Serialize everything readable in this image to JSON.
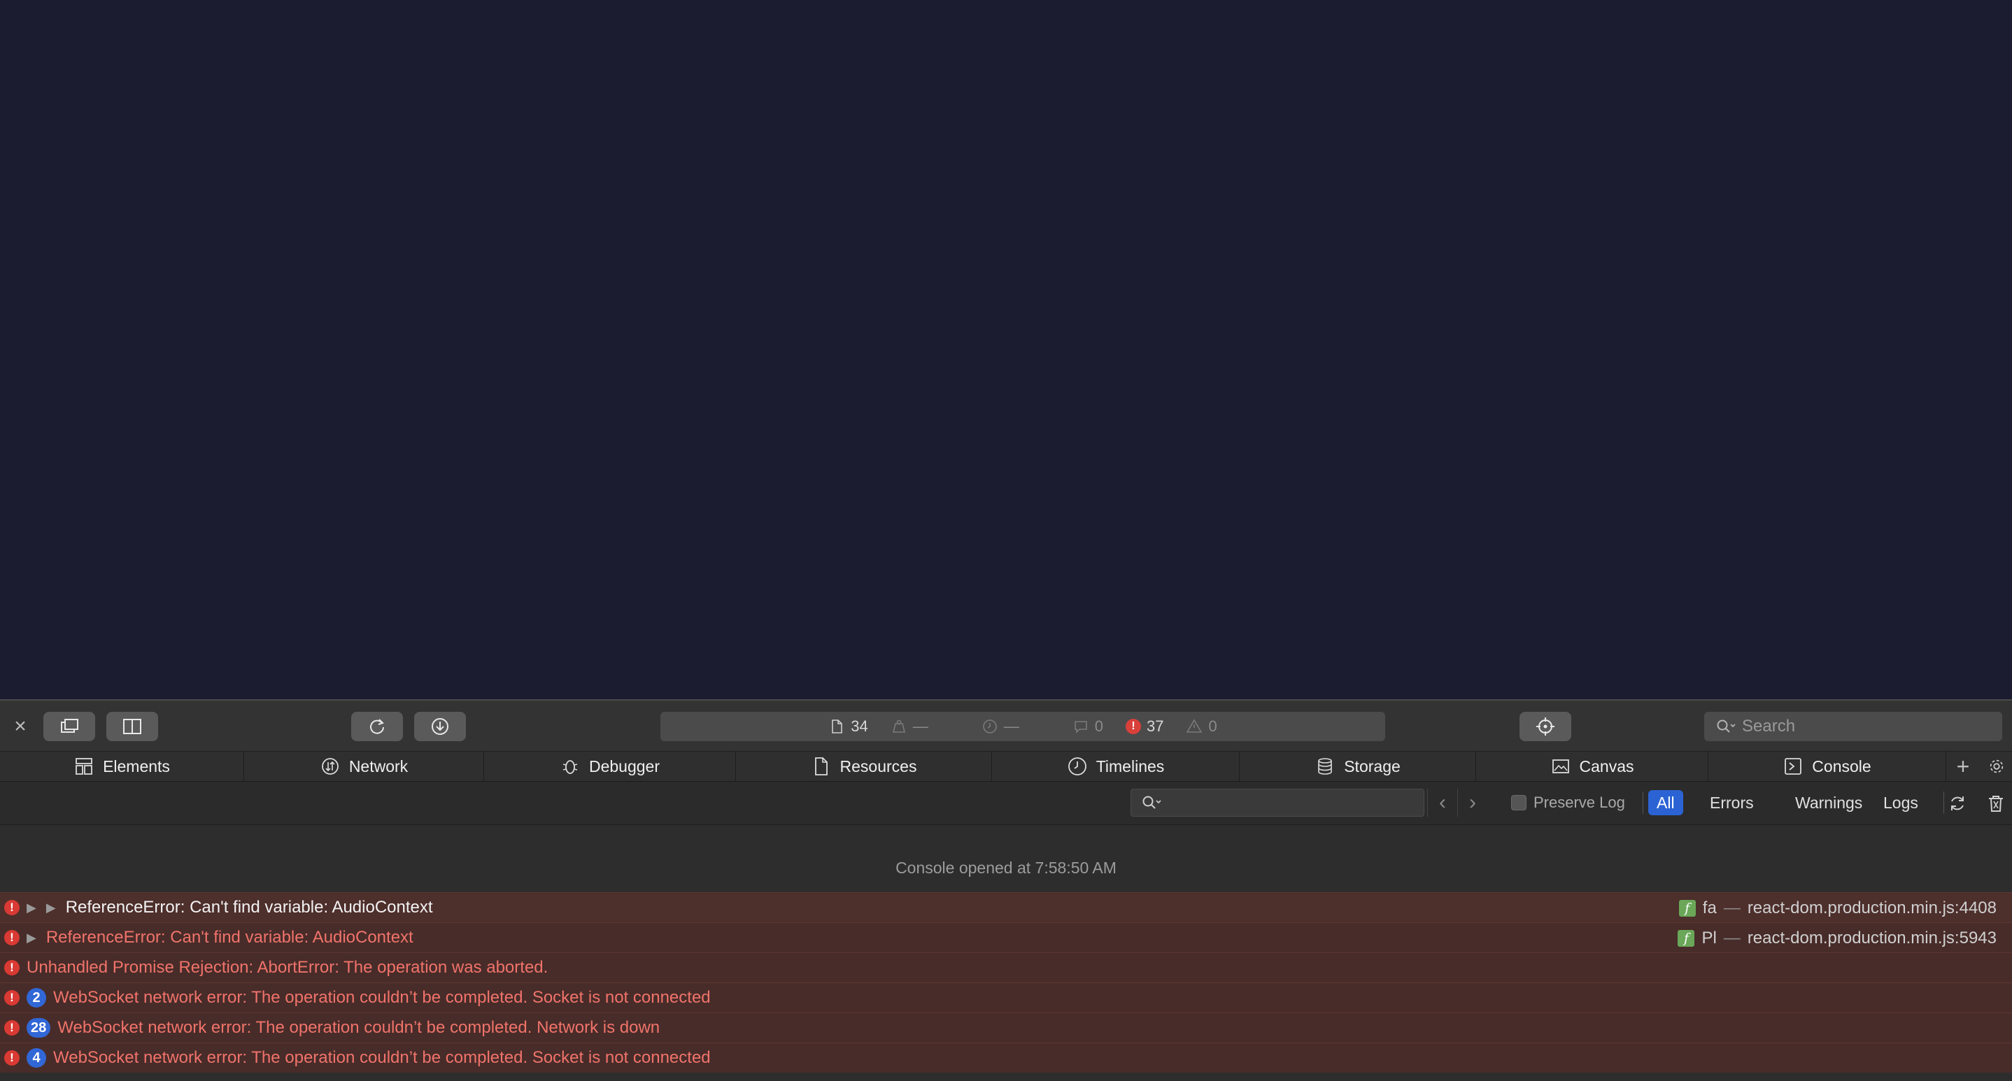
{
  "toolbar": {
    "close_glyph": "×",
    "activity": {
      "resources_count": "34",
      "resources_size": "—",
      "load_time": "—",
      "logs": "0",
      "errors": "37",
      "warnings": "0"
    },
    "search_placeholder": "Search"
  },
  "tabs": [
    {
      "label": "Elements",
      "icon": "elements-icon"
    },
    {
      "label": "Network",
      "icon": "network-icon"
    },
    {
      "label": "Debugger",
      "icon": "debugger-icon"
    },
    {
      "label": "Resources",
      "icon": "resources-icon"
    },
    {
      "label": "Timelines",
      "icon": "timelines-icon"
    },
    {
      "label": "Storage",
      "icon": "storage-icon"
    },
    {
      "label": "Canvas",
      "icon": "canvas-icon"
    },
    {
      "label": "Console",
      "icon": "console-icon"
    }
  ],
  "filter": {
    "preserve_log": "Preserve Log",
    "levels": [
      "All",
      "Errors",
      "Warnings",
      "Logs"
    ],
    "active_level": "All"
  },
  "console": {
    "opened_text": "Console opened at 7:58:50 AM",
    "messages": [
      {
        "text": "ReferenceError: Can't find variable: AudioContext",
        "fn": "fa",
        "source": "react-dom.production.min.js:4408"
      },
      {
        "text": "ReferenceError: Can't find variable: AudioContext",
        "fn": "Pl",
        "source": "react-dom.production.min.js:5943"
      },
      {
        "text": "Unhandled Promise Rejection: AbortError: The operation was aborted."
      },
      {
        "count": "2",
        "text": "WebSocket network error: The operation couldn’t be completed. Socket is not connected"
      },
      {
        "count": "28",
        "text": "WebSocket network error: The operation couldn’t be completed. Network is down"
      },
      {
        "count": "4",
        "text": "WebSocket network error: The operation couldn’t be completed. Socket is not connected"
      }
    ]
  },
  "colors": {
    "page_bg": "#1b1c30",
    "error_red": "#d93a33",
    "error_text": "#f0736b",
    "accent_blue": "#2b63d4"
  }
}
